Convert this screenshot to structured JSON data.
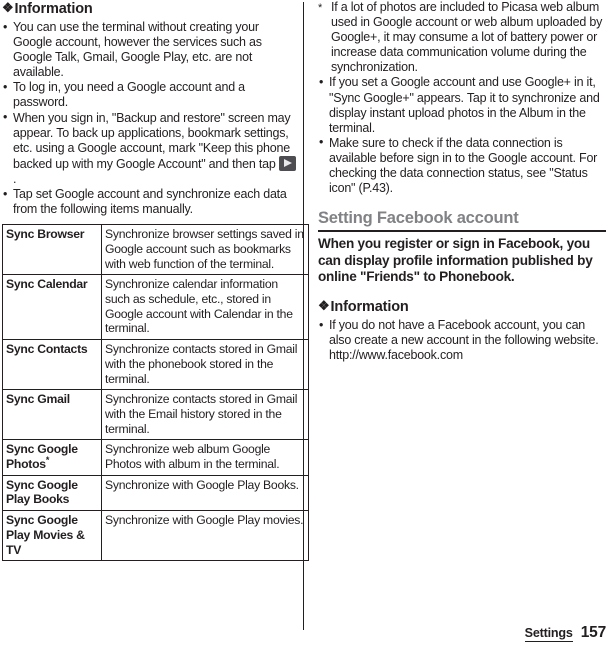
{
  "left_column": {
    "information_heading": {
      "icon": "diamond-icon",
      "label": "Information"
    },
    "bullets": [
      "You can use the terminal without creating your Google account, however the services such as Google Talk, Gmail, Google Play, etc. are not available.",
      "To log in, you need a Google account and a password.",
      "When you sign in, \"Backup and restore\" screen may appear. To back up applications, bookmark settings, etc. using a Google account, mark \"Keep this phone backed up with my Google Account\" and then tap",
      "Tap set Google account and synchronize each data from the following items manually."
    ],
    "bullet_3_trailing_period": ".",
    "key_glyph_name": "forward-key-icon",
    "table": {
      "rows": [
        {
          "term": "Sync Browser",
          "description": "Synchronize browser settings saved in Google account such as bookmarks with web function of the terminal."
        },
        {
          "term": "Sync Calendar",
          "description": "Synchronize calendar information such as schedule, etc., stored in Google account with Calendar in the terminal."
        },
        {
          "term": "Sync Contacts",
          "description": "Synchronize contacts stored in Gmail with the phonebook stored in the terminal."
        },
        {
          "term": "Sync Gmail",
          "description": "Synchronize contacts stored in Gmail with the Email history stored in the terminal."
        },
        {
          "term": "Sync Google Photos",
          "term_superscript": "*",
          "description": "Synchronize web album Google Photos with album in the terminal."
        },
        {
          "term": "Sync Google Play Books",
          "description": "Synchronize with Google Play Books."
        },
        {
          "term": "Sync Google Play Movies & TV",
          "description": "Synchronize with Google Play movies."
        }
      ]
    }
  },
  "right_column": {
    "footnote": {
      "marker": "*",
      "text": "If a lot of photos are included to Picasa web album used in Google account or web album uploaded by Google+, it may consume a lot of battery power or increase data communication volume during the synchronization."
    },
    "bullets": [
      "If you set a Google account and use Google+ in it, \"Sync Google+\" appears. Tap it to synchronize and display instant upload photos in the Album in the terminal.",
      "Make sure to check if the data connection is available before sign in to the Google account. For checking the data connection status, see \"Status icon\" (P.43)."
    ],
    "section": {
      "heading": "Setting Facebook account",
      "intro": "When you register or sign in Facebook, you can display profile information published by online \"Friends\" to Phonebook.",
      "information_heading": {
        "icon": "diamond-icon",
        "label": "Information"
      },
      "information_bullets": [
        "If you do not have a Facebook account, you can also create a new account in the following website. http://www.facebook.com"
      ]
    }
  },
  "footer": {
    "section_label": "Settings",
    "page_number": "157"
  },
  "colors": {
    "text": "#231f20",
    "heading_gray": "#808285",
    "key_glyph": "#4d4d52"
  }
}
